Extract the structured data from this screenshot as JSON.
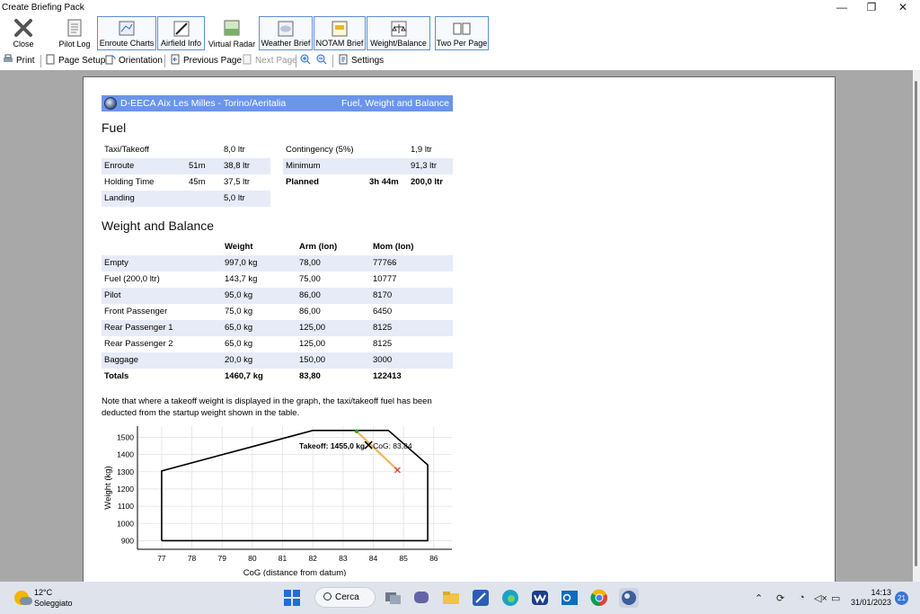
{
  "window": {
    "title": "Create Briefing Pack",
    "minimize": "—",
    "restore": "❐",
    "close": "✕"
  },
  "ribbon": [
    {
      "label": "Close",
      "icon": "close-x-icon"
    },
    {
      "label": "Pilot Log",
      "icon": "pilot-log-icon"
    },
    {
      "label": "Enroute Charts",
      "icon": "enroute-charts-icon"
    },
    {
      "label": "Airfield Info",
      "icon": "airfield-info-icon"
    },
    {
      "label": "Virtual Radar",
      "icon": "virtual-radar-icon"
    },
    {
      "label": "Weather Brief",
      "icon": "weather-brief-icon"
    },
    {
      "label": "NOTAM Brief",
      "icon": "notam-brief-icon"
    },
    {
      "label": "Weight/Balance",
      "icon": "weight-balance-icon"
    },
    {
      "label": "Two Per Page",
      "icon": "two-per-page-icon"
    }
  ],
  "toolbar": {
    "print": "Print",
    "page_setup": "Page Setup",
    "orientation": "Orientation",
    "previous_page": "Previous Page",
    "next_page": "Next Page",
    "settings": "Settings"
  },
  "header": {
    "left": "D-EECA Aix Les Milles - Torino/Aeritalia",
    "right": "Fuel, Weight and Balance"
  },
  "fuel": {
    "title": "Fuel",
    "left_rows": [
      {
        "label": "Taxi/Takeoff",
        "time": "",
        "value": "8,0 ltr"
      },
      {
        "label": "Enroute",
        "time": "51m",
        "value": "38,8 ltr"
      },
      {
        "label": "Holding Time",
        "time": "45m",
        "value": "37,5 ltr"
      },
      {
        "label": "Landing",
        "time": "",
        "value": "5,0 ltr"
      }
    ],
    "right_rows": [
      {
        "label": "Contingency (5%)",
        "time": "",
        "value": "1,9 ltr"
      },
      {
        "label": "Minimum",
        "time": "",
        "value": "91,3 ltr"
      },
      {
        "label": "Planned",
        "time": "3h 44m",
        "value": "200,0 ltr"
      }
    ]
  },
  "wb": {
    "title": "Weight and Balance",
    "headers": {
      "weight": "Weight",
      "arm": "Arm (lon)",
      "mom": "Mom (lon)"
    },
    "rows": [
      {
        "item": "Empty",
        "weight": "997,0 kg",
        "arm": "78,00",
        "mom": "77766"
      },
      {
        "item": "Fuel (200,0 ltr)",
        "weight": "143,7 kg",
        "arm": "75,00",
        "mom": "10777"
      },
      {
        "item": "Pilot",
        "weight": "95,0 kg",
        "arm": "86,00",
        "mom": "8170"
      },
      {
        "item": "Front Passenger",
        "weight": "75,0 kg",
        "arm": "86,00",
        "mom": "6450"
      },
      {
        "item": "Rear Passenger 1",
        "weight": "65,0 kg",
        "arm": "125,00",
        "mom": "8125"
      },
      {
        "item": "Rear Passenger 2",
        "weight": "65,0 kg",
        "arm": "125,00",
        "mom": "8125"
      },
      {
        "item": "Baggage",
        "weight": "20,0 kg",
        "arm": "150,00",
        "mom": "3000"
      },
      {
        "item": "Totals",
        "weight": "1460,7 kg",
        "arm": "83,80",
        "mom": "122413"
      }
    ]
  },
  "note": "Note that where a takeoff weight is displayed in the graph, the taxi/takeoff fuel has been deducted from the startup weight shown in the table.",
  "chart_data": {
    "type": "line",
    "xlabel": "CoG (distance from datum)",
    "ylabel": "Weight (kg)",
    "xlim": [
      76.2,
      86.6
    ],
    "ylim": [
      850,
      1565
    ],
    "xticks": [
      77,
      78,
      79,
      80,
      81,
      82,
      83,
      84,
      85,
      86
    ],
    "yticks": [
      900,
      1000,
      1100,
      1200,
      1300,
      1400,
      1500
    ],
    "grid": true,
    "series": [
      {
        "name": "",
        "x": [
          77,
          77,
          82,
          84.5,
          85.8,
          85.8,
          77
        ],
        "y": [
          900,
          1305,
          1540,
          1540,
          1340,
          900,
          900
        ]
      }
    ],
    "cog_path": {
      "x": [
        83.45,
        84.8
      ],
      "y": [
        1535,
        1310
      ]
    },
    "point": {
      "x": 83.84,
      "y": 1455,
      "label": "Takeoff: 1455,0 kg",
      "cog_label": "CoG: 83,84"
    }
  },
  "taskbar": {
    "weather_temp": "12°C",
    "weather_desc": "Soleggiato",
    "search": "Cerca",
    "time": "14:13",
    "date": "31/01/2023",
    "notifications": "21"
  }
}
